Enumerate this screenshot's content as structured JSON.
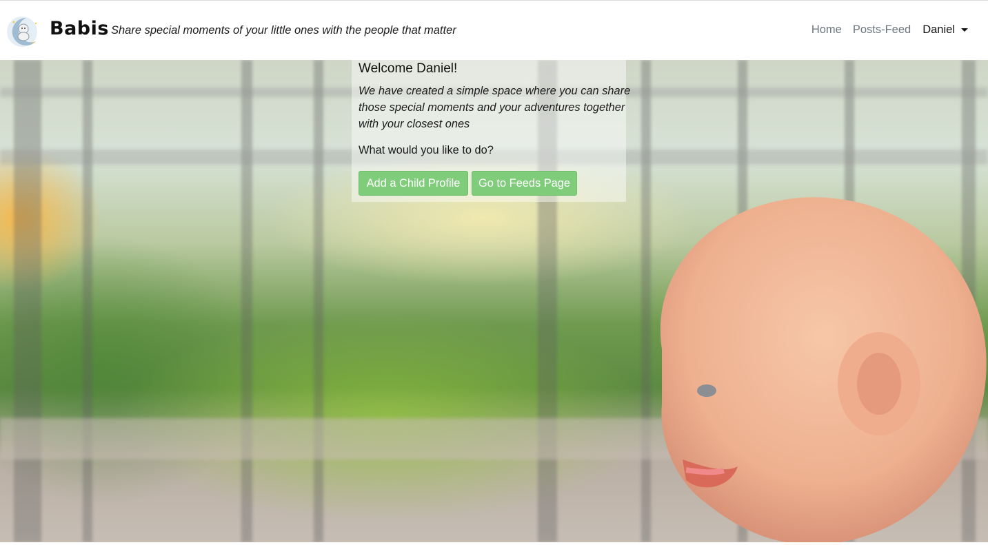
{
  "brand": {
    "name": "Babis",
    "tagline": "Share special moments of your little ones with the people that matter",
    "logo_icon": "moon-baby-logo-icon"
  },
  "nav": {
    "links": [
      "Home",
      "Posts-Feed"
    ],
    "user": "Daniel"
  },
  "hero": {
    "title": "Welcome Daniel!",
    "description": "We have created a simple space where you can share those special moments and your adventures together with your closest ones",
    "question": "What would you like to do?",
    "buttons": {
      "add_child": "Add a Child Profile",
      "go_feed": "Go to Feeds Page"
    }
  },
  "colors": {
    "button_green": "#7fcc7a",
    "nav_link_gray": "#6c757d"
  }
}
